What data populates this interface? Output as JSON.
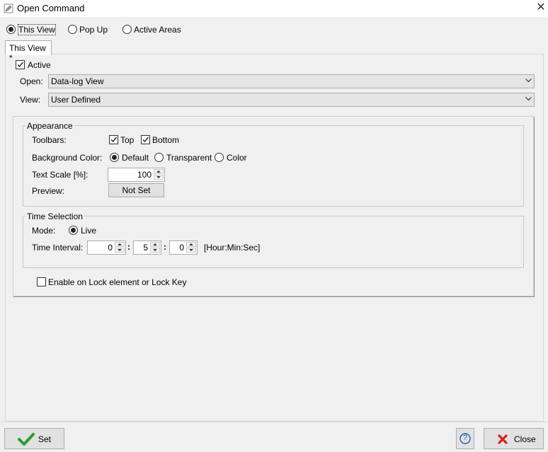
{
  "window": {
    "title": "Open Command"
  },
  "mode_radios": [
    {
      "label": "This View",
      "selected": true
    },
    {
      "label": "Pop Up",
      "selected": false
    },
    {
      "label": "Active Areas",
      "selected": false
    }
  ],
  "tab": {
    "label": "This View *"
  },
  "active_label": "Active",
  "open": {
    "label": "Open:",
    "value": "Data-log View"
  },
  "view": {
    "label": "View:",
    "value": "User Defined"
  },
  "appearance": {
    "title": "Appearance",
    "toolbars_label": "Toolbars:",
    "toolbar_top": "Top",
    "toolbar_bottom": "Bottom",
    "bg_label": "Background Color:",
    "bg_default": "Default",
    "bg_transparent": "Transparent",
    "bg_color": "Color",
    "text_scale_label": "Text Scale [%]:",
    "text_scale_value": "100",
    "preview_label": "Preview:",
    "preview_button": "Not Set"
  },
  "time": {
    "title": "Time Selection",
    "mode_label": "Mode:",
    "mode_live": "Live",
    "interval_label": "Time Interval:",
    "hour": "0",
    "min": "5",
    "sec": "0",
    "sep": ":",
    "format": "[Hour:Min:Sec]"
  },
  "lock_label": "Enable on Lock element or Lock Key",
  "buttons": {
    "set": "Set",
    "help": "?",
    "close": "Close"
  },
  "colors": {
    "check_green": "#2e9b2e",
    "close_red": "#d42020",
    "help_blue": "#1f5fa8"
  }
}
